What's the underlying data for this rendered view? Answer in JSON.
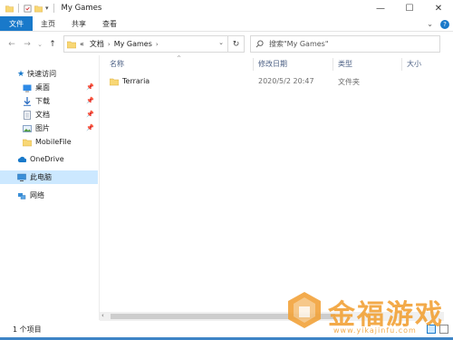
{
  "window": {
    "title": "My Games"
  },
  "ribbon": {
    "tabs": [
      "文件",
      "主页",
      "共享",
      "查看"
    ]
  },
  "address": {
    "overflow": "«",
    "crumbs": [
      "文档",
      "My Games"
    ]
  },
  "search": {
    "placeholder": "搜索\"My Games\""
  },
  "sidebar": {
    "items": [
      {
        "label": "快速访问",
        "icon": "star-icon"
      },
      {
        "label": "桌面",
        "icon": "desktop-icon",
        "pinned": true
      },
      {
        "label": "下载",
        "icon": "download-icon",
        "pinned": true
      },
      {
        "label": "文档",
        "icon": "document-icon",
        "pinned": true
      },
      {
        "label": "图片",
        "icon": "picture-icon",
        "pinned": true
      },
      {
        "label": "MobileFile",
        "icon": "folder-icon"
      },
      {
        "label": "OneDrive",
        "icon": "cloud-icon"
      },
      {
        "label": "此电脑",
        "icon": "computer-icon",
        "selected": true
      },
      {
        "label": "网络",
        "icon": "network-icon"
      }
    ]
  },
  "columns": [
    "名称",
    "修改日期",
    "类型",
    "大小"
  ],
  "files": [
    {
      "name": "Terraria",
      "modified": "2020/5/2 20:47",
      "type": "文件夹",
      "size": ""
    }
  ],
  "status": {
    "count": "1 个项目"
  },
  "watermark": {
    "text": "金福游戏",
    "url": "www.yikajinfu.com"
  },
  "colors": {
    "accent": "#1979ca",
    "selected_bg": "#cce8ff",
    "folder": "#f8d775",
    "watermark": "#f2a33a"
  }
}
